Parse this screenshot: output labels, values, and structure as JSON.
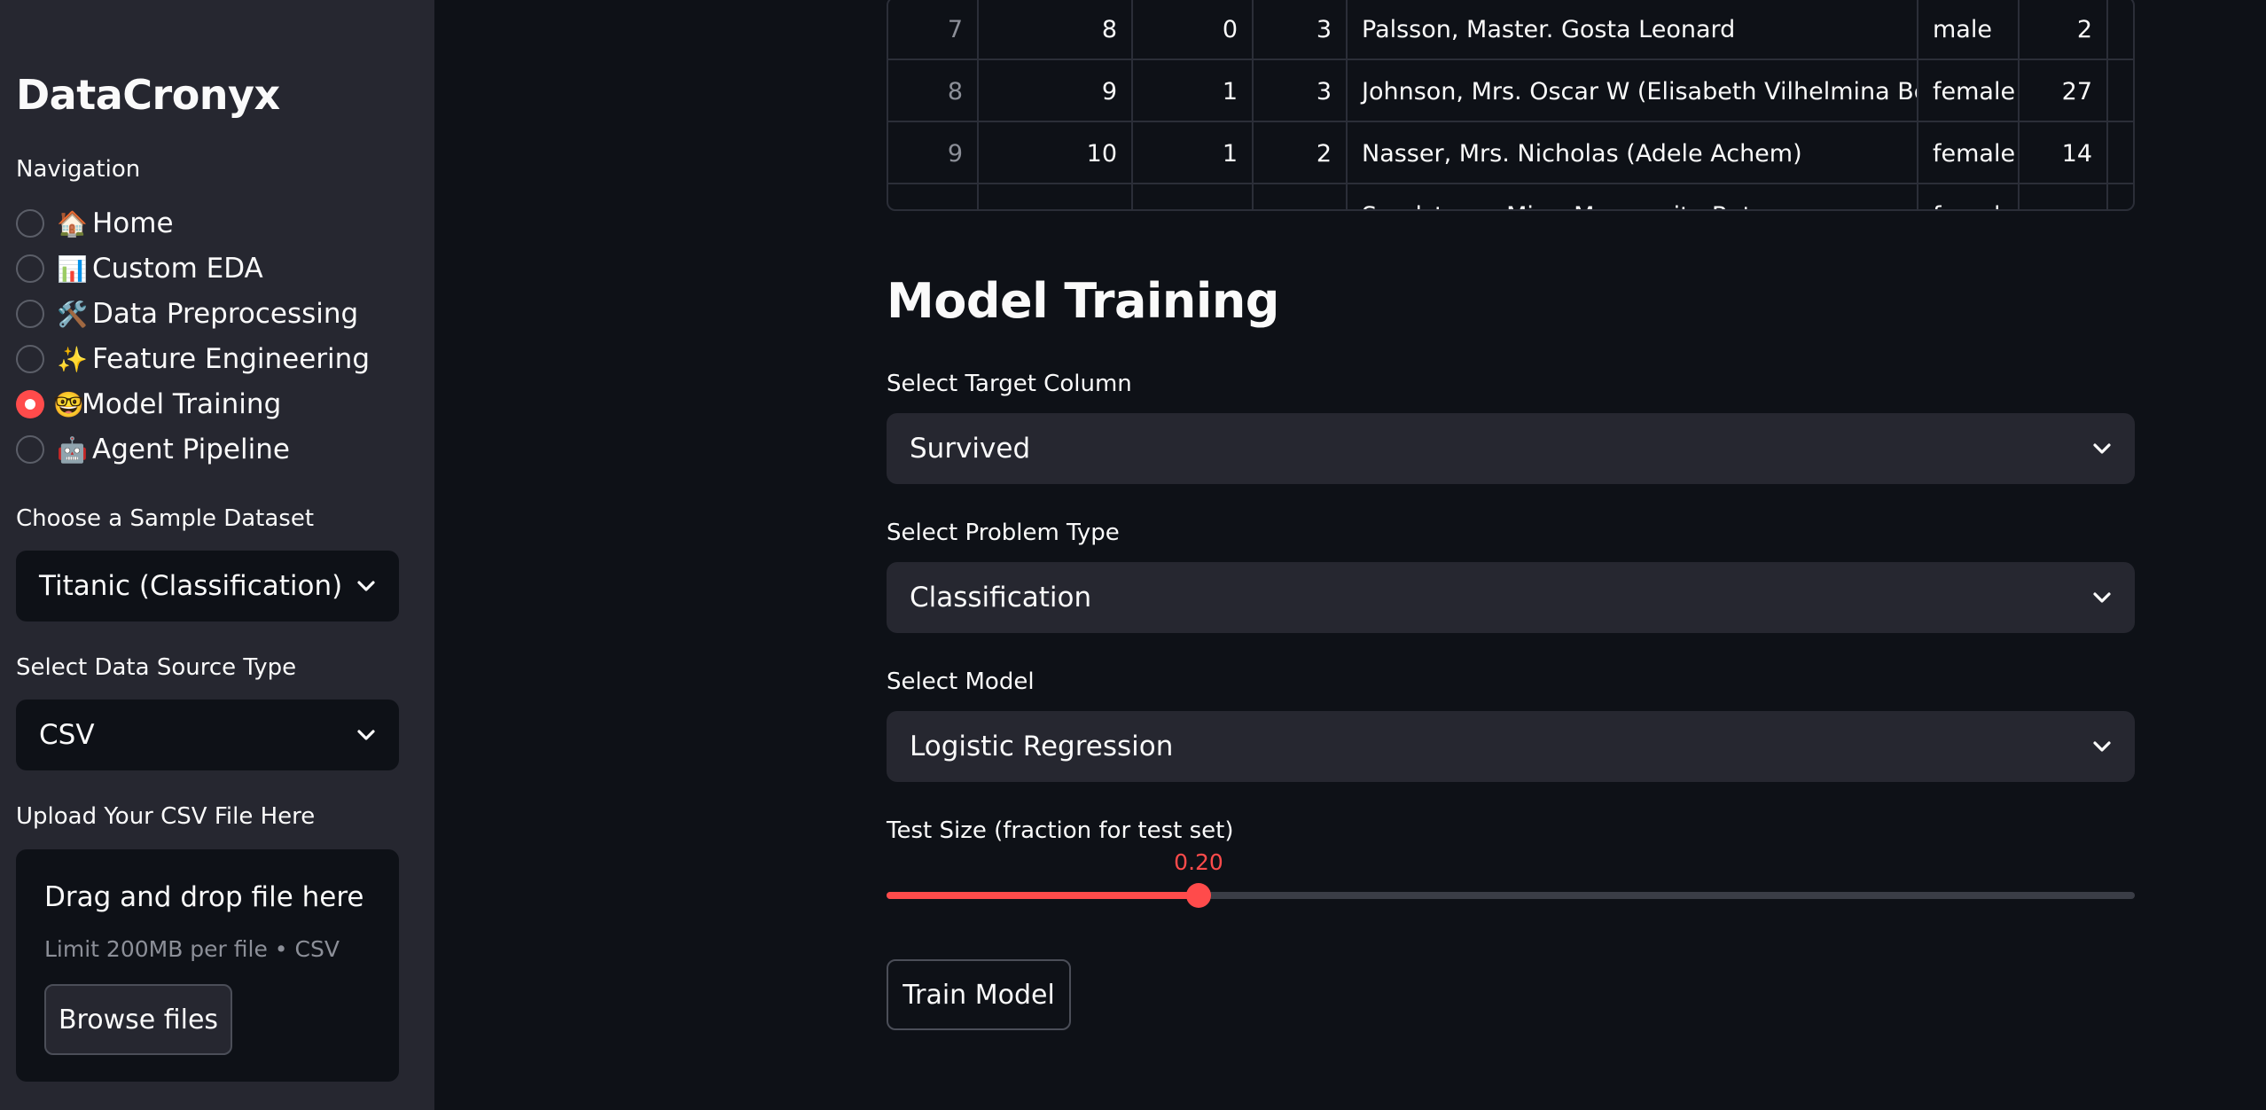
{
  "sidebar": {
    "brand": "DataCronyx",
    "nav_label": "Navigation",
    "nav_items": [
      {
        "icon": "🏠",
        "label": "Home",
        "checked": false
      },
      {
        "icon": "📊",
        "label": "Custom EDA",
        "checked": false
      },
      {
        "icon": "🛠️",
        "label": "Data Preprocessing",
        "checked": false
      },
      {
        "icon": "✨",
        "label": "Feature Engineering",
        "checked": false
      },
      {
        "icon": "🤓",
        "label": "Model Training",
        "checked": true
      },
      {
        "icon": "🤖",
        "label": "Agent Pipeline",
        "checked": false
      }
    ],
    "dataset_label": "Choose a Sample Dataset",
    "dataset_value": "Titanic (Classification)",
    "source_label": "Select Data Source Type",
    "source_value": "CSV",
    "upload_label": "Upload Your CSV File Here",
    "upload_title": "Drag and drop file here",
    "upload_sub": "Limit 200MB per file • CSV",
    "browse_label": "Browse files"
  },
  "table": {
    "rows": [
      {
        "index": "7",
        "PassengerId": "8",
        "Survived": "0",
        "Pclass": "3",
        "Name": "Palsson, Master. Gosta Leonard",
        "Sex": "male",
        "Age": "2"
      },
      {
        "index": "8",
        "PassengerId": "9",
        "Survived": "1",
        "Pclass": "3",
        "Name": "Johnson, Mrs. Oscar W (Elisabeth Vilhelmina Berg)",
        "Sex": "female",
        "Age": "27"
      },
      {
        "index": "9",
        "PassengerId": "10",
        "Survived": "1",
        "Pclass": "2",
        "Name": "Nasser, Mrs. Nicholas (Adele Achem)",
        "Sex": "female",
        "Age": "14"
      },
      {
        "index": "",
        "PassengerId": "",
        "Survived": "",
        "Pclass": "",
        "Name": "Sandstrom, Miss. Marguerite Rut",
        "Sex": "female",
        "Age": ""
      }
    ]
  },
  "main": {
    "title": "Model Training",
    "target_label": "Select Target Column",
    "target_value": "Survived",
    "problem_label": "Select Problem Type",
    "problem_value": "Classification",
    "model_label": "Select Model",
    "model_value": "Logistic Regression",
    "slider_label": "Test Size (fraction for test set)",
    "slider_value_text": "0.20",
    "slider_fraction": 0.25,
    "train_label": "Train Model"
  },
  "colors": {
    "accent": "#ff4b4b",
    "app_bg": "#0e1117",
    "sidebar_bg": "#262730"
  }
}
